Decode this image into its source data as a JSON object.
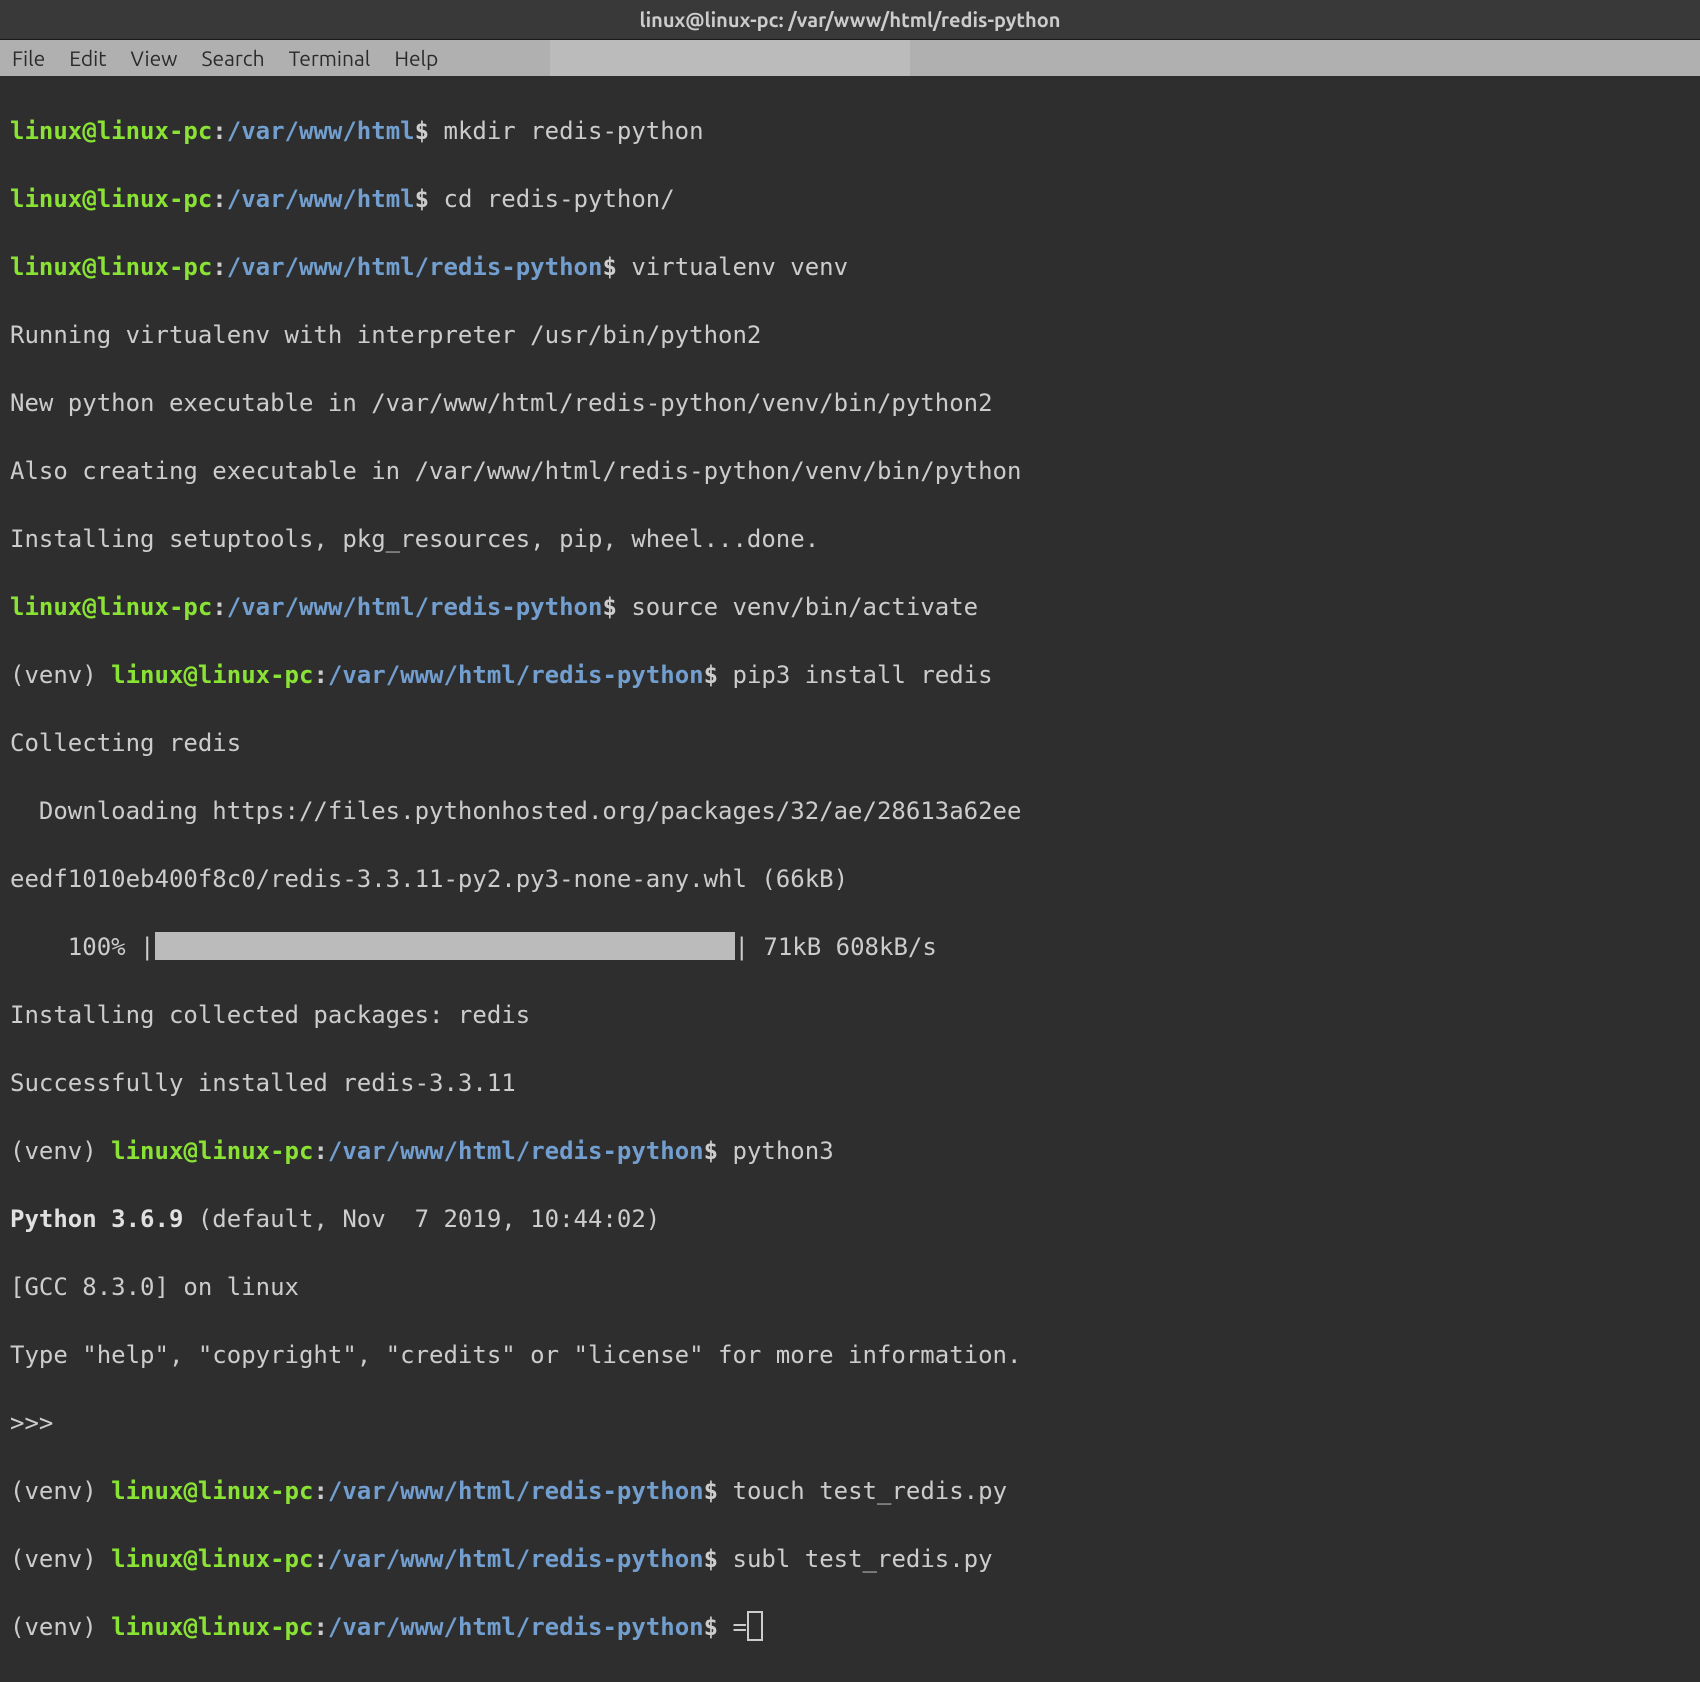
{
  "titlebar": {
    "title": "linux@linux-pc: /var/www/html/redis-python"
  },
  "menubar": {
    "items": [
      "File",
      "Edit",
      "View",
      "Search",
      "Terminal",
      "Help"
    ]
  },
  "prompts": {
    "user": "linux@linux-pc",
    "colon": ":",
    "path_short": "/var/www/html",
    "path_long": "/var/www/html/redis-python",
    "dollar": "$",
    "venv": "(venv) "
  },
  "commands": {
    "mkdir": " mkdir redis-python",
    "cd": " cd redis-python/",
    "virtualenv": " virtualenv venv",
    "source": " source venv/bin/activate",
    "pip": " pip3 install redis",
    "python3": " python3",
    "touch": " touch test_redis.py",
    "subl": " subl test_redis.py",
    "eq": " ="
  },
  "output": {
    "venv1": "Running virtualenv with interpreter /usr/bin/python2",
    "venv2": "New python executable in /var/www/html/redis-python/venv/bin/python2",
    "venv3": "Also creating executable in /var/www/html/redis-python/venv/bin/python",
    "venv4": "Installing setuptools, pkg_resources, pip, wheel...done.",
    "pip1": "Collecting redis",
    "pip2": "  Downloading https://files.pythonhosted.org/packages/32/ae/28613a62ee",
    "pip3": "eedf1010eb400f8c0/redis-3.3.11-py2.py3-none-any.whl (66kB)",
    "progress_left": "    100% |",
    "progress_right": "| 71kB 608kB/s",
    "pip4": "Installing collected packages: redis",
    "pip5": "Successfully installed redis-3.3.11",
    "py_version": "Python 3.6.9 ",
    "py_version2": "(default, Nov  7 2019, 10:44:02) ",
    "py_gcc": "[GCC 8.3.0] on linux",
    "py_help": "Type \"help\", \"copyright\", \"credits\" or \"license\" for more information.",
    "py_prompt": ">>> "
  }
}
